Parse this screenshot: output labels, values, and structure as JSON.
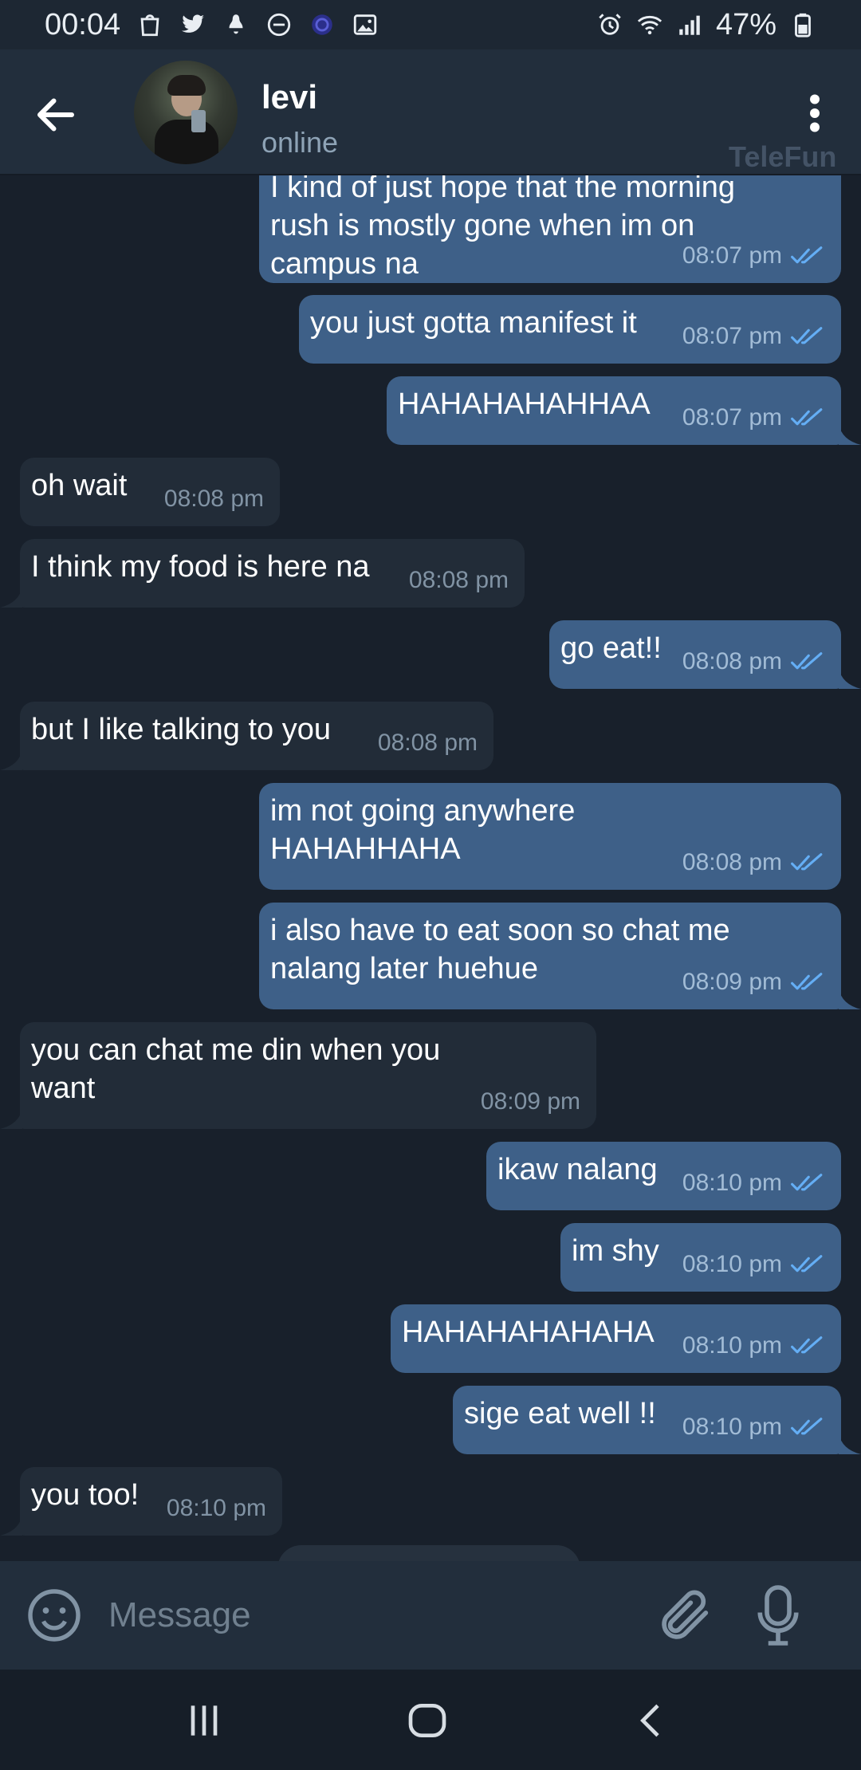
{
  "status_bar": {
    "time": "00:04",
    "battery": "47%",
    "left_icons": [
      "shop-icon",
      "twitter-icon",
      "notification-icon",
      "dnd-icon",
      "app-icon",
      "gallery-icon"
    ],
    "right_icons": [
      "alarm-icon",
      "wifi-icon",
      "signal-icon",
      "battery-icon"
    ]
  },
  "header": {
    "contact_name": "levi",
    "contact_status": "online",
    "watermark": "TeleFun"
  },
  "messages": [
    {
      "dir": "out",
      "text": "I kind of just hope that the morning rush is mostly gone when im on campus na",
      "lines": [
        "I kind of just hope that the morning",
        "rush is mostly gone when im on",
        "campus na"
      ],
      "time": "08:07 pm",
      "read": true,
      "tail": false
    },
    {
      "dir": "out",
      "text": "you just gotta manifest it",
      "lines": [
        "you just gotta manifest it"
      ],
      "time": "08:07 pm",
      "read": true,
      "tail": false
    },
    {
      "dir": "out",
      "text": "HAHAHAHAHHAA",
      "lines": [
        "HAHAHAHAHHAA"
      ],
      "time": "08:07 pm",
      "read": true,
      "tail": true
    },
    {
      "dir": "in",
      "text": "oh wait",
      "lines": [
        "oh wait"
      ],
      "time": "08:08 pm",
      "tail": false
    },
    {
      "dir": "in",
      "text": "I think my food is here na",
      "lines": [
        "I think my food is here na"
      ],
      "time": "08:08 pm",
      "tail": true
    },
    {
      "dir": "out",
      "text": "go eat!!",
      "lines": [
        "go eat!!"
      ],
      "time": "08:08 pm",
      "read": true,
      "tail": true
    },
    {
      "dir": "in",
      "text": "but I like talking to you",
      "lines": [
        "but I like talking to you"
      ],
      "time": "08:08 pm",
      "tail": true
    },
    {
      "dir": "out",
      "text": "im not going anywhere HAHAHHAHA",
      "lines": [
        "im not going anywhere",
        "HAHAHHAHA"
      ],
      "time": "08:08 pm",
      "read": true,
      "tail": false
    },
    {
      "dir": "out",
      "text": "i also have to eat soon so chat me nalang later huehue",
      "lines": [
        "i also have to eat soon so chat me",
        "nalang later huehue"
      ],
      "time": "08:09 pm",
      "read": true,
      "tail": true
    },
    {
      "dir": "in",
      "text": "you can chat me din when you want",
      "lines": [
        "you can chat me din when you",
        "want"
      ],
      "time": "08:09 pm",
      "tail": true
    },
    {
      "dir": "out",
      "text": "ikaw nalang",
      "lines": [
        "ikaw nalang"
      ],
      "time": "08:10 pm",
      "read": true,
      "tail": false
    },
    {
      "dir": "out",
      "text": "im shy",
      "lines": [
        "im shy"
      ],
      "time": "08:10 pm",
      "read": true,
      "tail": false
    },
    {
      "dir": "out",
      "text": "HAHAHAHAHAHA",
      "lines": [
        "HAHAHAHAHAHA"
      ],
      "time": "08:10 pm",
      "read": true,
      "tail": false
    },
    {
      "dir": "out",
      "text": "sige eat well !!",
      "lines": [
        "sige eat well !!"
      ],
      "time": "08:10 pm",
      "read": true,
      "tail": true
    },
    {
      "dir": "in",
      "text": "you too!",
      "lines": [
        "you too!"
      ],
      "time": "08:10 pm",
      "tail": true
    }
  ],
  "input": {
    "placeholder": "Message",
    "value": ""
  },
  "nav_bar": {
    "buttons": [
      "recents-icon",
      "home-icon",
      "back-nav-icon"
    ]
  },
  "colors": {
    "background": "#18202b",
    "header": "#222e3c",
    "outgoing_bubble": "#3e6088",
    "incoming_bubble": "#222c38",
    "read_check": "#64aef5",
    "placeholder": "#70808f"
  }
}
